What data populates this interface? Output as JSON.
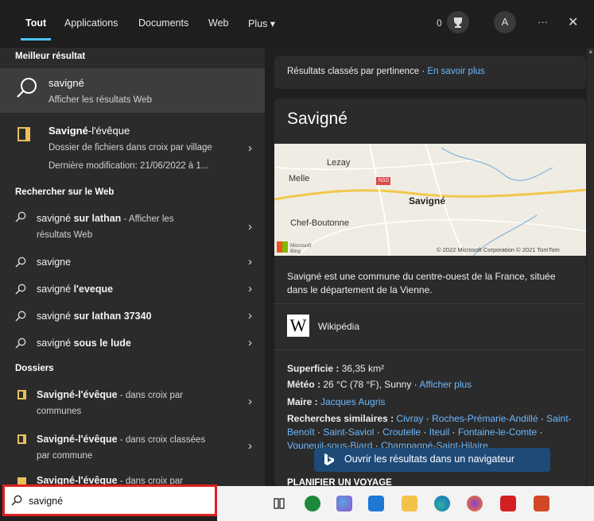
{
  "tabs": [
    "Tout",
    "Applications",
    "Documents",
    "Web",
    "Plus ▾"
  ],
  "header": {
    "points": "0",
    "avatar_letter": "A",
    "more": "···",
    "close": "✕"
  },
  "best_match": {
    "heading": "Meilleur résultat",
    "title": "savigné",
    "subtitle": "Afficher les résultats Web"
  },
  "folder_result": {
    "title_bold": "Savigné",
    "title_rest": "-l'évêque",
    "line1": "Dossier de fichiers dans croix par village",
    "line2": "Dernière modification: 21/06/2022 à 1..."
  },
  "web_section": {
    "heading": "Rechercher sur le Web",
    "items": [
      {
        "pre": "savigné ",
        "bold": "sur lathan",
        "post": " - Afficher les",
        "line2": "résultats Web"
      },
      {
        "pre": "savigne",
        "bold": "",
        "post": "",
        "line2": ""
      },
      {
        "pre": "savigné ",
        "bold": "l'eveque",
        "post": "",
        "line2": ""
      },
      {
        "pre": "savigné ",
        "bold": "sur lathan 37340",
        "post": "",
        "line2": ""
      },
      {
        "pre": "savigné ",
        "bold": "sous le lude",
        "post": "",
        "line2": ""
      }
    ]
  },
  "folders_section": {
    "heading": "Dossiers",
    "items": [
      {
        "bold": "Savigné",
        "rest": "-l'évêque",
        "desc": " - dans croix par",
        "line2": "communes"
      },
      {
        "bold": "Savigné",
        "rest": "-l'évêque",
        "desc": " - dans croix classées",
        "line2": "par commune"
      },
      {
        "bold": "Savigné",
        "rest": "-l'évêque",
        "desc": " - dans croix par",
        "line2": ""
      }
    ]
  },
  "right": {
    "ranking_text": "Résultats classés par pertinence · ",
    "ranking_link": "En savoir plus",
    "title": "Savigné",
    "map": {
      "labels": [
        "Lezay",
        "Melle",
        "Savigné",
        "Chef-Boutonne",
        "N10"
      ],
      "provider": "Microsoft Bing",
      "copyright": "© 2022 Microsoft Corporation © 2021 TomTom"
    },
    "description": "Savigné est une commune du centre-ouest de la France, située dans le département de la Vienne.",
    "wiki": {
      "logo": "W",
      "label": "Wikipédia"
    },
    "facts": {
      "surface_label": "Superficie : ",
      "surface_value": "36,35 km²",
      "weather_label": "Météo : ",
      "weather_value": "26 °C (78 °F), Sunny",
      "weather_link": "Afficher plus",
      "mayor_label": "Maire : ",
      "mayor_value": "Jacques Augris",
      "similar_label": "Recherches similaires : ",
      "similar_values": [
        "Civray",
        "Roches-Prémarie-Andillé",
        "Saint-Benoît",
        "Saint-Saviol",
        "Croutelle",
        "Iteuil",
        "Fontaine-le-Comte",
        "Vouneuil-sous-Biard",
        "Champagné-Saint-Hilaire"
      ]
    },
    "open_button": "Ouvrir les résultats dans un navigateur",
    "plan_heading": "PLANIFIER UN VOYAGE"
  },
  "searchbox": {
    "value": "savigné"
  },
  "taskbar_icons": [
    "task-view",
    "app-green",
    "paint",
    "mail",
    "explorer",
    "edge",
    "firefox",
    "acrobat",
    "powerpoint"
  ]
}
